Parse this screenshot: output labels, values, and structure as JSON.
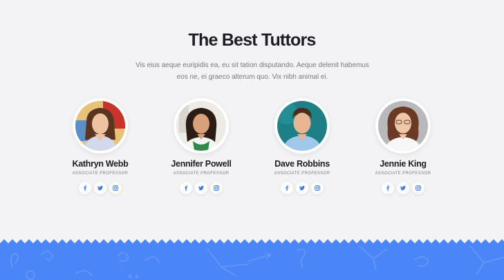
{
  "section": {
    "title": "The Best Tuttors",
    "subtitle": "Vis eius aeque euripidis ea, eu sit tation disputando. Aeque delenit habemus eos ne, ei graeco alterum quo. Vix nibh animal ei."
  },
  "team": [
    {
      "name": "Kathryn Webb",
      "role": "ASSOCIATE PROFESSOR",
      "photo": "kathryn-webb-photo"
    },
    {
      "name": "Jennifer Powell",
      "role": "ASSOCIATE PROFESSOR",
      "photo": "jennifer-powell-photo"
    },
    {
      "name": "Dave Robbins",
      "role": "ASSOCIATE PROFESSOR",
      "photo": "dave-robbins-photo"
    },
    {
      "name": "Jennie King",
      "role": "ASSOCIATE PROFESSOR",
      "photo": "jennie-king-photo"
    }
  ],
  "social_icons": [
    "facebook-icon",
    "twitter-icon",
    "instagram-icon"
  ],
  "colors": {
    "background": "#f3f2f4",
    "heading": "#1d1d26",
    "body_text": "#777a82",
    "social_icon": "#3d7bf6",
    "footer_band": "#4a86f7"
  }
}
